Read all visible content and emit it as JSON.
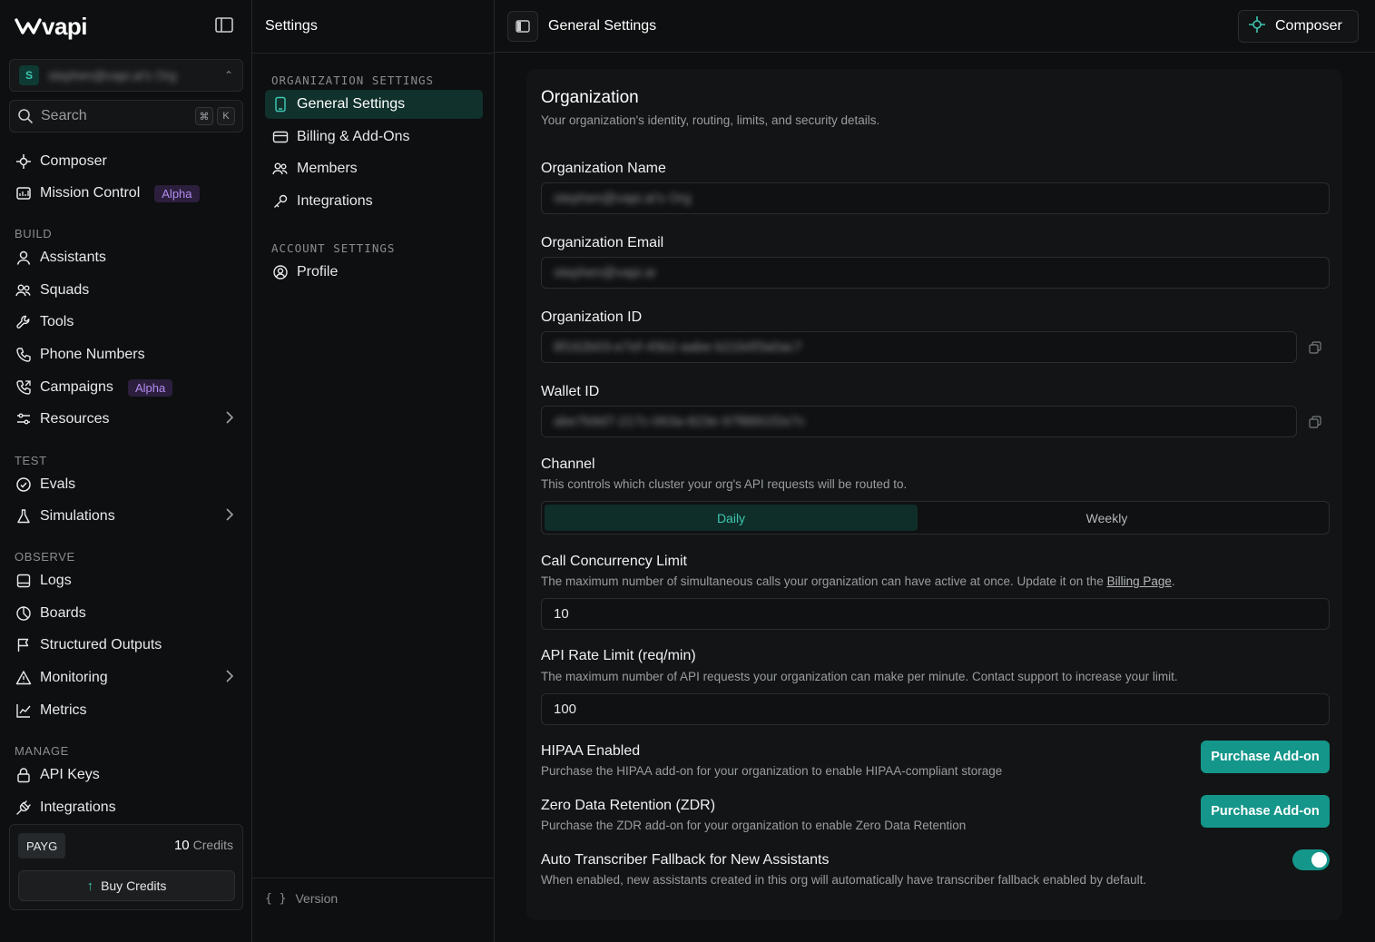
{
  "brand": {
    "name": "vapi"
  },
  "org_selector": {
    "initial": "S",
    "name": "stephen@vapi.ai's Org"
  },
  "search": {
    "label": "Search",
    "shortcut_mod": "⌘",
    "shortcut_key": "K"
  },
  "nav": {
    "top": [
      {
        "label": "Composer",
        "icon": "composer-icon"
      },
      {
        "label": "Mission Control",
        "icon": "dashboard-icon",
        "badge": "Alpha"
      }
    ],
    "build_label": "BUILD",
    "build": [
      {
        "label": "Assistants",
        "icon": "user-icon"
      },
      {
        "label": "Squads",
        "icon": "users-icon"
      },
      {
        "label": "Tools",
        "icon": "wrench-icon"
      },
      {
        "label": "Phone Numbers",
        "icon": "phone-icon"
      },
      {
        "label": "Campaigns",
        "icon": "phone-outgoing-icon",
        "badge": "Alpha"
      },
      {
        "label": "Resources",
        "icon": "sliders-icon"
      }
    ],
    "test_label": "TEST",
    "test": [
      {
        "label": "Evals",
        "icon": "check-circle-icon"
      },
      {
        "label": "Simulations",
        "icon": "flask-icon"
      }
    ],
    "observe_label": "OBSERVE",
    "observe": [
      {
        "label": "Logs",
        "icon": "logs-icon"
      },
      {
        "label": "Boards",
        "icon": "pie-chart-icon"
      },
      {
        "label": "Structured Outputs",
        "icon": "flag-icon"
      },
      {
        "label": "Monitoring",
        "icon": "alert-triangle-icon"
      },
      {
        "label": "Metrics",
        "icon": "line-chart-icon"
      }
    ],
    "manage_label": "MANAGE",
    "manage": [
      {
        "label": "API Keys",
        "icon": "lock-icon"
      },
      {
        "label": "Integrations",
        "icon": "plug-icon"
      }
    ]
  },
  "credits": {
    "plan": "PAYG",
    "amount": "10",
    "unit": "Credits",
    "buy_label": "Buy Credits"
  },
  "settings_pane": {
    "title": "Settings",
    "org_section": "ORGANIZATION SETTINGS",
    "org_items": [
      {
        "label": "General Settings",
        "active": true
      },
      {
        "label": "Billing & Add-Ons"
      },
      {
        "label": "Members"
      },
      {
        "label": "Integrations"
      }
    ],
    "account_section": "ACCOUNT SETTINGS",
    "account_items": [
      {
        "label": "Profile"
      }
    ],
    "version_label": "Version",
    "version_glyph": "{ }"
  },
  "topbar": {
    "title": "General Settings",
    "composer_label": "Composer"
  },
  "organization": {
    "heading": "Organization",
    "description": "Your organization's identity, routing, limits, and security details.",
    "name_label": "Organization Name",
    "name_value": "stephen@vapi.ai's Org",
    "email_label": "Organization Email",
    "email_value": "stephen@vapi.ai",
    "id_label": "Organization ID",
    "id_value": "8f162b03-e7ef-45b2-aabe-b21b0f3a0ac7",
    "wallet_label": "Wallet ID",
    "wallet_value": "abe7b9d7-217c-063a-823e-97f8891f2e7c",
    "channel_label": "Channel",
    "channel_desc": "This controls which cluster your org's API requests will be routed to.",
    "channel_options": [
      "Daily",
      "Weekly"
    ],
    "channel_selected": "Daily",
    "concurrency_label": "Call Concurrency Limit",
    "concurrency_desc": "The maximum number of simultaneous calls your organization can have active at once. Update it on the",
    "concurrency_link": "Billing Page",
    "concurrency_value": "10",
    "rate_label": "API Rate Limit (req/min)",
    "rate_desc": "The maximum number of API requests your organization can make per minute. Contact support to increase your limit.",
    "rate_value": "100",
    "hipaa_label": "HIPAA Enabled",
    "hipaa_desc": "Purchase the HIPAA add-on for your organization to enable HIPAA-compliant storage",
    "zdr_label": "Zero Data Retention (ZDR)",
    "zdr_desc": "Purchase the ZDR add-on for your organization to enable Zero Data Retention",
    "purchase_label": "Purchase Add-on",
    "fallback_label": "Auto Transcriber Fallback for New Assistants",
    "fallback_desc": "When enabled, new assistants created in this org will automatically have transcriber fallback enabled by default.",
    "fallback_enabled": true
  },
  "colors": {
    "accent": "#14968a",
    "accent_text": "#3ec6b0",
    "badge_bg": "#2b1f3d",
    "badge_text": "#b48cf0"
  }
}
